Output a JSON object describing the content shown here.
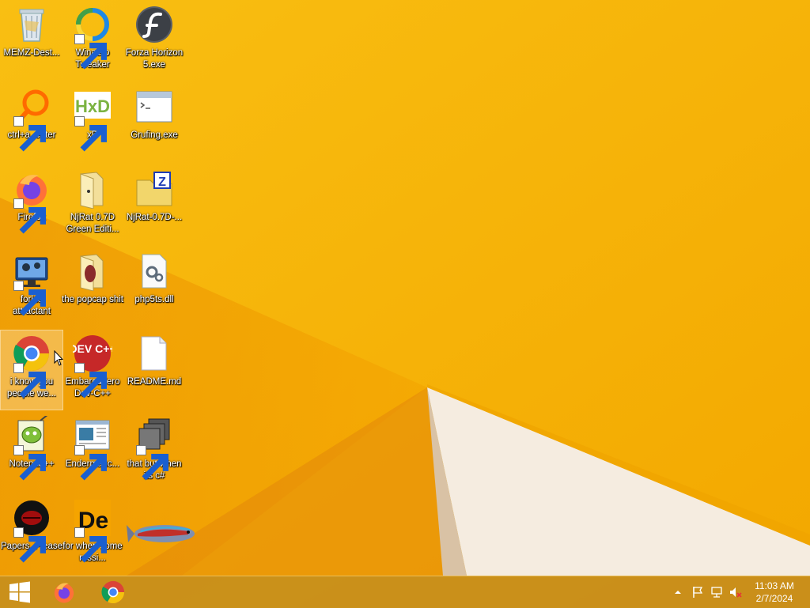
{
  "desktop": {
    "icons": [
      {
        "label": "MEMZ-Dest...",
        "icon": "recycle-bin-icon"
      },
      {
        "label": "Winaero Tweaker",
        "icon": "winaero-tweaker-icon"
      },
      {
        "label": "Forza Horizon 5.exe",
        "icon": "flash-player-icon"
      },
      {
        "label": "ctrl+a, enter",
        "icon": "magnifier-icon"
      },
      {
        "label": "xD",
        "icon": "hxd-icon"
      },
      {
        "label": "Grufing.exe",
        "icon": "console-window-icon"
      },
      {
        "label": "Firefox",
        "icon": "firefox-icon"
      },
      {
        "label": "NjRat 0.7D Green Editi...",
        "icon": "folder-icon"
      },
      {
        "label": "NjRat-0.7D-...",
        "icon": "zip-folder-icon"
      },
      {
        "label": "forkie attractant",
        "icon": "computer-settings-icon"
      },
      {
        "label": "the popcap shit",
        "icon": "folder-icon"
      },
      {
        "label": "php5ts.dll",
        "icon": "dll-file-icon"
      },
      {
        "label": "i know you people we...",
        "icon": "chrome-icon"
      },
      {
        "label": "Embarcadero Dev-C++",
        "icon": "devcpp-icon"
      },
      {
        "label": "README.md",
        "icon": "blank-file-icon"
      },
      {
        "label": "Notepad++",
        "icon": "notepadpp-icon"
      },
      {
        "label": "Endermanc...",
        "icon": "document-window-icon"
      },
      {
        "label": "that but when its c#",
        "icon": "stacked-windows-icon"
      },
      {
        "label": "Papers, Please",
        "icon": "papers-please-icon"
      },
      {
        "label": "for when some russi...",
        "icon": "de-icon"
      }
    ],
    "devcpp_text": "DEV C++",
    "de_text": "De",
    "hxd_text": "HxD",
    "zip_letter": "Z"
  },
  "taskbar": {
    "start_icon": "windows-logo-icon",
    "pinned": [
      {
        "name": "Firefox",
        "icon": "firefox-icon"
      },
      {
        "name": "Google Chrome",
        "icon": "chrome-icon"
      }
    ],
    "tray": {
      "overflow_icon": "chevron-up-icon",
      "flag_icon": "action-center-flag-icon",
      "network_icon": "network-icon",
      "volume_icon": "volume-muted-icon"
    },
    "clock": {
      "time": "11:03 AM",
      "date": "2/7/2024"
    }
  }
}
